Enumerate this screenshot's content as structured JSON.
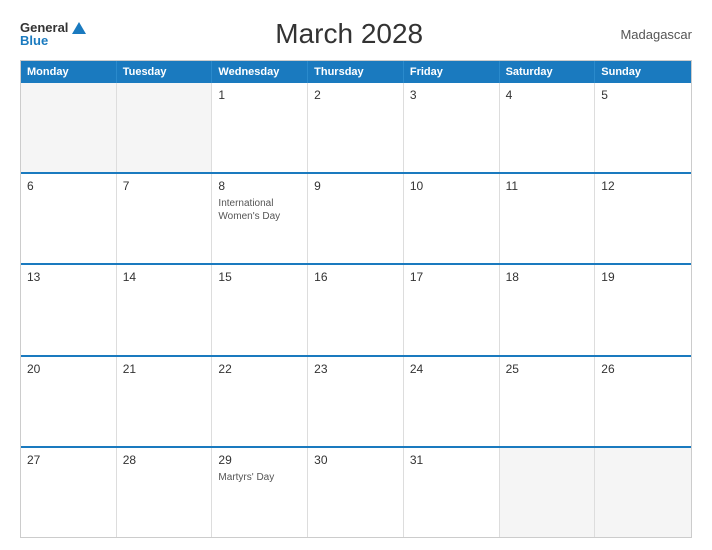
{
  "header": {
    "title": "March 2028",
    "country": "Madagascar",
    "logo_general": "General",
    "logo_blue": "Blue"
  },
  "weekdays": [
    "Monday",
    "Tuesday",
    "Wednesday",
    "Thursday",
    "Friday",
    "Saturday",
    "Sunday"
  ],
  "weeks": [
    [
      {
        "num": "",
        "empty": true
      },
      {
        "num": "",
        "empty": true
      },
      {
        "num": "1",
        "empty": false,
        "event": ""
      },
      {
        "num": "2",
        "empty": false,
        "event": ""
      },
      {
        "num": "3",
        "empty": false,
        "event": ""
      },
      {
        "num": "4",
        "empty": false,
        "event": ""
      },
      {
        "num": "5",
        "empty": false,
        "event": ""
      }
    ],
    [
      {
        "num": "6",
        "empty": false,
        "event": ""
      },
      {
        "num": "7",
        "empty": false,
        "event": ""
      },
      {
        "num": "8",
        "empty": false,
        "event": "International Women's Day"
      },
      {
        "num": "9",
        "empty": false,
        "event": ""
      },
      {
        "num": "10",
        "empty": false,
        "event": ""
      },
      {
        "num": "11",
        "empty": false,
        "event": ""
      },
      {
        "num": "12",
        "empty": false,
        "event": ""
      }
    ],
    [
      {
        "num": "13",
        "empty": false,
        "event": ""
      },
      {
        "num": "14",
        "empty": false,
        "event": ""
      },
      {
        "num": "15",
        "empty": false,
        "event": ""
      },
      {
        "num": "16",
        "empty": false,
        "event": ""
      },
      {
        "num": "17",
        "empty": false,
        "event": ""
      },
      {
        "num": "18",
        "empty": false,
        "event": ""
      },
      {
        "num": "19",
        "empty": false,
        "event": ""
      }
    ],
    [
      {
        "num": "20",
        "empty": false,
        "event": ""
      },
      {
        "num": "21",
        "empty": false,
        "event": ""
      },
      {
        "num": "22",
        "empty": false,
        "event": ""
      },
      {
        "num": "23",
        "empty": false,
        "event": ""
      },
      {
        "num": "24",
        "empty": false,
        "event": ""
      },
      {
        "num": "25",
        "empty": false,
        "event": ""
      },
      {
        "num": "26",
        "empty": false,
        "event": ""
      }
    ],
    [
      {
        "num": "27",
        "empty": false,
        "event": ""
      },
      {
        "num": "28",
        "empty": false,
        "event": ""
      },
      {
        "num": "29",
        "empty": false,
        "event": "Martyrs' Day"
      },
      {
        "num": "30",
        "empty": false,
        "event": ""
      },
      {
        "num": "31",
        "empty": false,
        "event": ""
      },
      {
        "num": "",
        "empty": true
      },
      {
        "num": "",
        "empty": true
      }
    ]
  ],
  "colors": {
    "header_bg": "#1a7abf",
    "border_accent": "#1a7abf"
  }
}
